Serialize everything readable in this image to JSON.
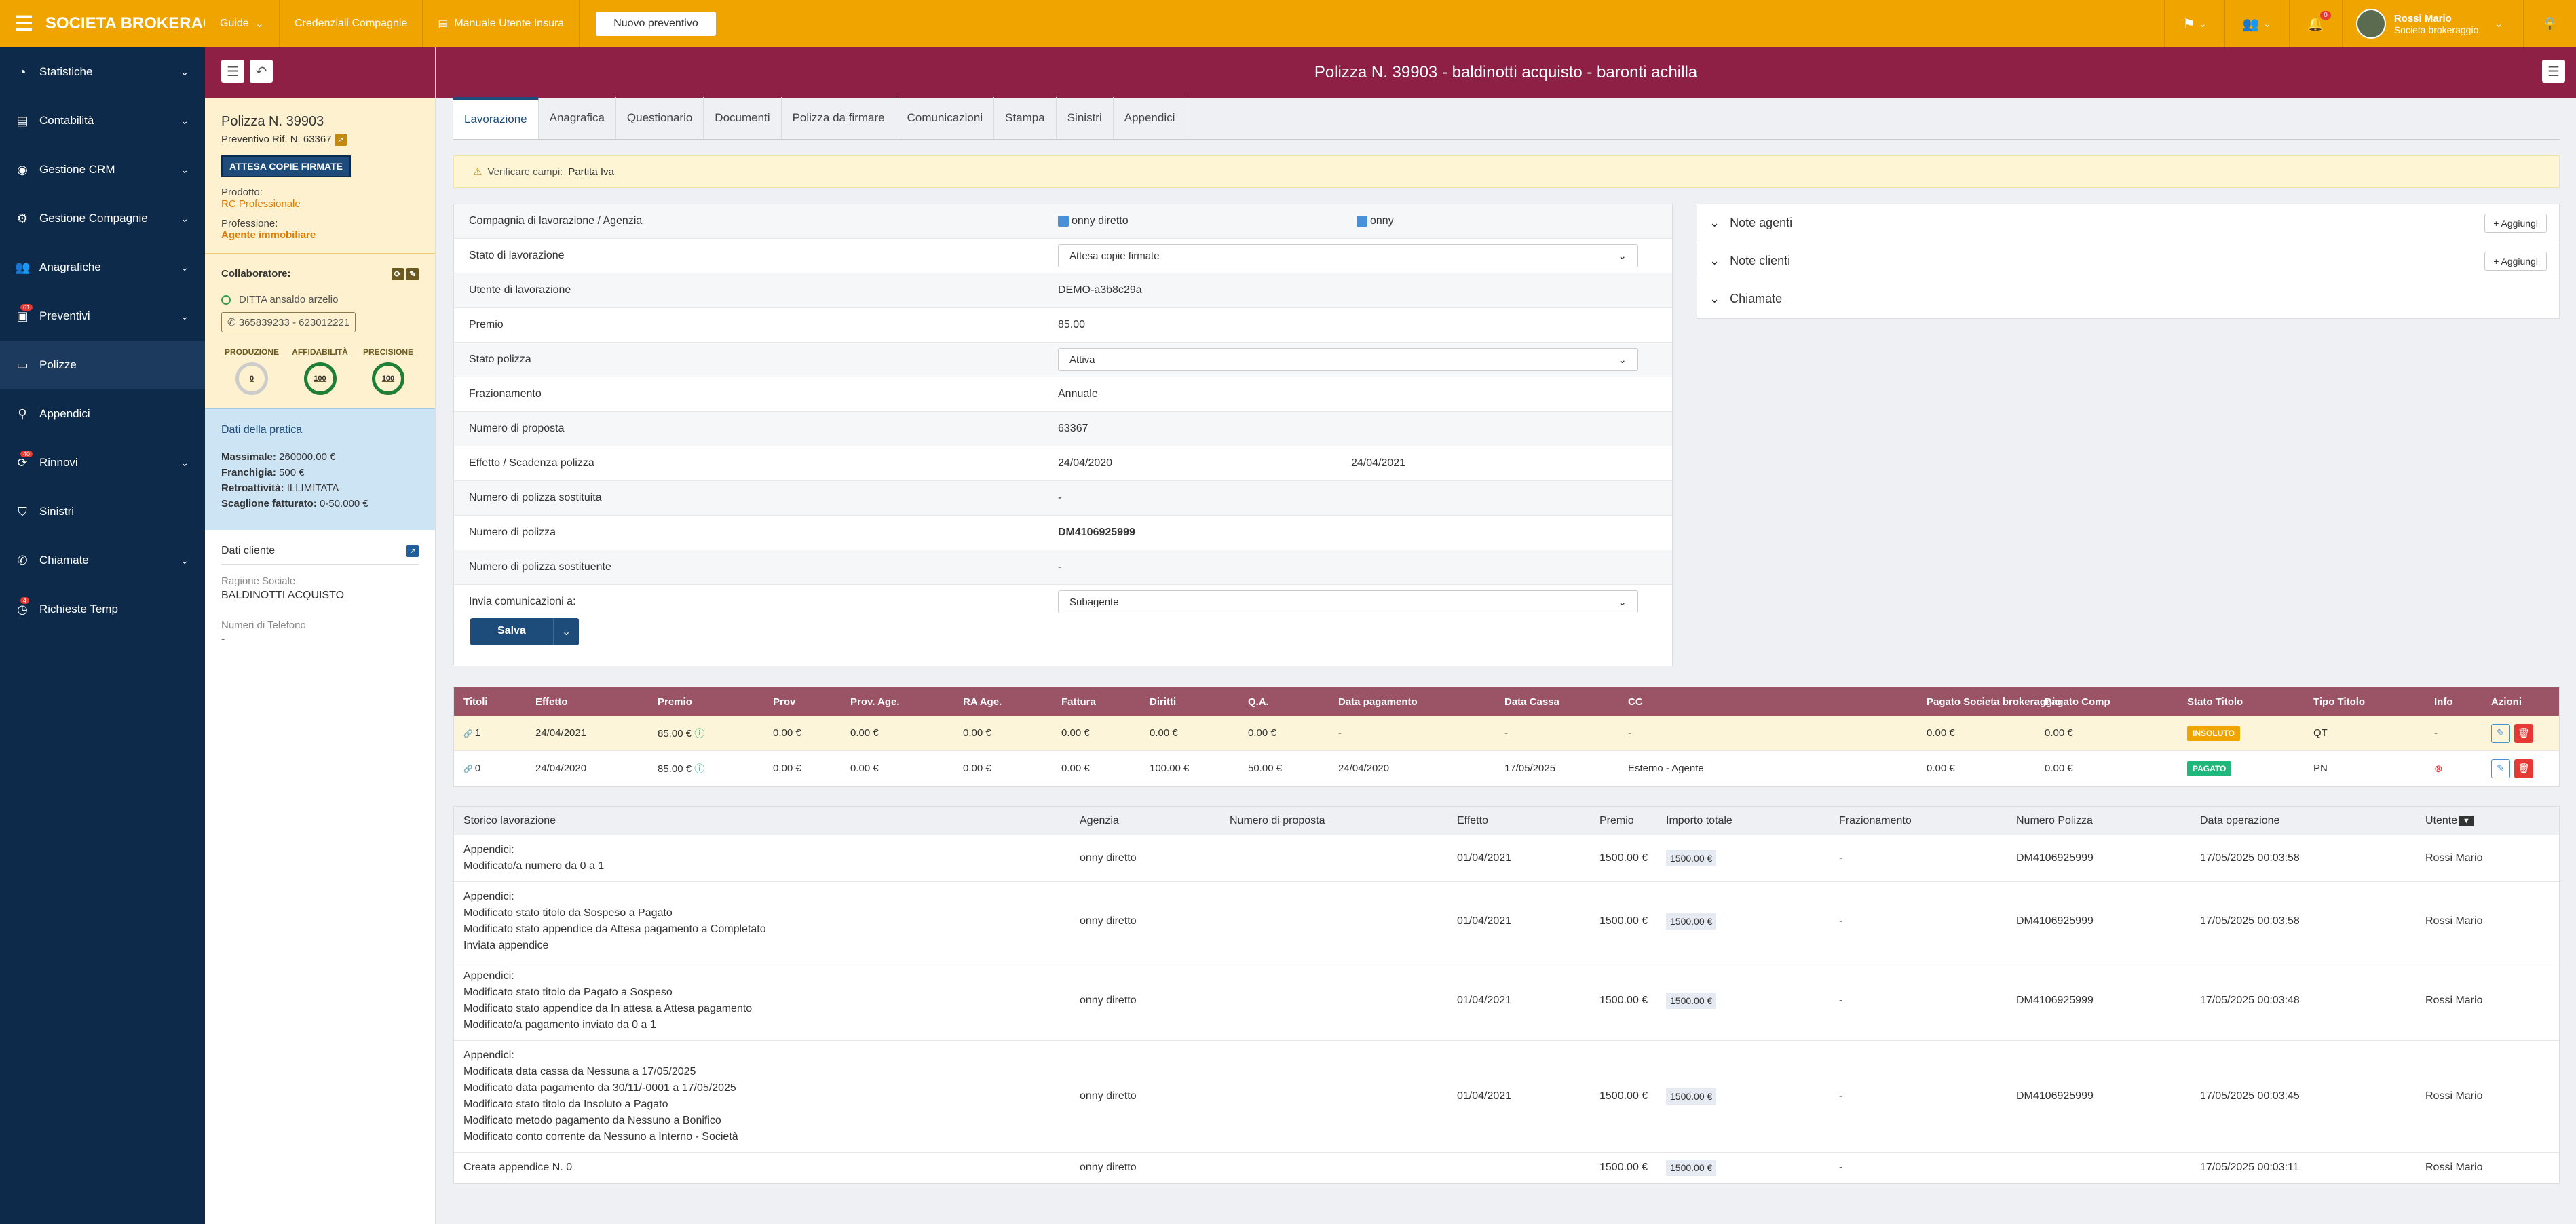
{
  "topbar": {
    "brand": "SOCIETA BROKERAG...",
    "nav": [
      "Guide",
      "Credenziali Compagnie",
      "Manuale Utente Insura"
    ],
    "new_button": "Nuovo preventivo",
    "user_name": "Rossi Mario",
    "user_role": "Societa brokeraggio",
    "notif_count": "0",
    "colors": {
      "accent": "#f0a400"
    }
  },
  "sidebar": {
    "items": [
      {
        "label": "Statistiche",
        "icon": "chart-icon",
        "chevron": true,
        "badge": ""
      },
      {
        "label": "Contabilità",
        "icon": "ledger-icon",
        "chevron": true,
        "badge": ""
      },
      {
        "label": "Gestione CRM",
        "icon": "crm-icon",
        "chevron": true,
        "badge": ""
      },
      {
        "label": "Gestione Compagnie",
        "icon": "building-icon",
        "chevron": true,
        "badge": ""
      },
      {
        "label": "Anagrafiche",
        "icon": "people-icon",
        "chevron": true,
        "badge": ""
      },
      {
        "label": "Preventivi",
        "icon": "document-icon",
        "chevron": true,
        "badge": "61"
      },
      {
        "label": "Polizze",
        "icon": "policy-icon",
        "chevron": false,
        "badge": ""
      },
      {
        "label": "Appendici",
        "icon": "appendix-icon",
        "chevron": false,
        "badge": ""
      },
      {
        "label": "Rinnovi",
        "icon": "refresh-icon",
        "chevron": true,
        "badge": "40"
      },
      {
        "label": "Sinistri",
        "icon": "shield-icon",
        "chevron": false,
        "badge": ""
      },
      {
        "label": "Chiamate",
        "icon": "phone-icon",
        "chevron": true,
        "badge": ""
      },
      {
        "label": "Richieste Temp",
        "icon": "clock-icon",
        "chevron": false,
        "badge": "4"
      }
    ]
  },
  "header": {
    "title": "Polizza N. 39903 - baldinotti acquisto - baronti achilla"
  },
  "left": {
    "policy_title": "Polizza N. 39903",
    "preventivo": "Preventivo Rif. N. 63367",
    "status": "ATTESA COPIE FIRMATE",
    "prodotto_label": "Prodotto:",
    "prodotto": "RC Professionale",
    "professione_label": "Professione:",
    "professione": "Agente immobiliare",
    "collaboratore_label": "Collaboratore:",
    "ditta": "DITTA ansaldo arzelio",
    "phone": "365839233 - 623012221",
    "metrics": [
      {
        "label": "PRODUZIONE",
        "value": "0"
      },
      {
        "label": "AFFIDABILITÀ",
        "value": "100"
      },
      {
        "label": "PRECISIONE",
        "value": "100"
      }
    ],
    "dati_title": "Dati della pratica",
    "dati": [
      {
        "k": "Massimale:",
        "v": "260000.00 €"
      },
      {
        "k": "Franchigia:",
        "v": "500 €"
      },
      {
        "k": "Retroattività:",
        "v": "ILLIMITATA"
      },
      {
        "k": "Scaglione fatturato:",
        "v": "0-50.000 €"
      }
    ],
    "cliente_title": "Dati cliente",
    "ragione_label": "Ragione Sociale",
    "ragione": "BALDINOTTI ACQUISTO",
    "tel_label": "Numeri di Telefono",
    "tel": "-"
  },
  "tabs": [
    "Lavorazione",
    "Anagrafica",
    "Questionario",
    "Documenti",
    "Polizza da firmare",
    "Comunicazioni",
    "Stampa",
    "Sinistri",
    "Appendici"
  ],
  "warning": {
    "text": "Verificare campi:",
    "field": "Partita Iva"
  },
  "form": {
    "rows": [
      {
        "label": "Compagnia di lavorazione / Agenzia",
        "type": "check",
        "v1": "onny diretto",
        "v2": "onny"
      },
      {
        "label": "Stato di lavorazione",
        "type": "select",
        "v1": "Attesa copie firmate"
      },
      {
        "label": "Utente di lavorazione",
        "type": "text",
        "v1": "DEMO-a3b8c29a"
      },
      {
        "label": "Premio",
        "type": "text",
        "v1": "85.00"
      },
      {
        "label": "Stato polizza",
        "type": "select",
        "v1": "Attiva"
      },
      {
        "label": "Frazionamento",
        "type": "text",
        "v1": "Annuale"
      },
      {
        "label": "Numero di proposta",
        "type": "text",
        "v1": "63367"
      },
      {
        "label": "Effetto / Scadenza polizza",
        "type": "two",
        "v1": "24/04/2020",
        "v2": "24/04/2021"
      },
      {
        "label": "Numero di polizza sostituita",
        "type": "text",
        "v1": "-"
      },
      {
        "label": "Numero di polizza",
        "type": "bold",
        "v1": "DM4106925999"
      },
      {
        "label": "Numero di polizza sostituente",
        "type": "text",
        "v1": "-"
      },
      {
        "label": "Invia comunicazioni a:",
        "type": "select",
        "v1": "Subagente"
      }
    ],
    "save": "Salva"
  },
  "notes": [
    {
      "label": "Note agenti",
      "add": "+ Aggiungi"
    },
    {
      "label": "Note clienti",
      "add": "+ Aggiungi"
    },
    {
      "label": "Chiamate",
      "add": ""
    }
  ],
  "titoli": {
    "headers": [
      "Titoli",
      "Effetto",
      "Premio",
      "Prov",
      "Prov. Age.",
      "RA Age.",
      "Fattura",
      "Diritti",
      "Q.A.",
      "Data pagamento",
      "Data Cassa",
      "CC",
      "Pagato Societa brokeraggio",
      "Pagato Comp",
      "Stato Titolo",
      "Tipo Titolo",
      "Info",
      "Azioni"
    ],
    "rows": [
      {
        "n": "1",
        "effetto": "24/04/2021",
        "premio": "85.00 €",
        "prov": "0.00 €",
        "prov_age": "0.00 €",
        "ra": "0.00 €",
        "fattura": "0.00 €",
        "diritti": "0.00 €",
        "qa": "0.00 €",
        "data_pag": "-",
        "cassa": "-",
        "cc": "-",
        "pag_soc": "0.00 €",
        "pag_comp": "0.00 €",
        "stato": "INSOLUTO",
        "stato_color": "#f0a400",
        "tipo": "QT",
        "info": "-"
      },
      {
        "n": "0",
        "effetto": "24/04/2020",
        "premio": "85.00 €",
        "prov": "0.00 €",
        "prov_age": "0.00 €",
        "ra": "0.00 €",
        "fattura": "0.00 €",
        "diritti": "100.00 €",
        "qa": "50.00 €",
        "data_pag": "24/04/2020",
        "cassa": "17/05/2025",
        "cc": "Esterno - Agente",
        "pag_soc": "0.00 €",
        "pag_comp": "0.00 €",
        "stato": "PAGATO",
        "stato_color": "#1fb87a",
        "tipo": "PN",
        "info": ""
      }
    ]
  },
  "storico": {
    "headers": [
      "Storico lavorazione",
      "Agenzia",
      "Numero di proposta",
      "Effetto",
      "Premio",
      "Importo totale",
      "Frazionamento",
      "Numero Polizza",
      "Data operazione",
      "Utente"
    ],
    "rows": [
      {
        "lines": [
          "Appendici:",
          "Modificato/a numero da 0 a 1"
        ],
        "agenzia": "onny diretto",
        "effetto": "01/04/2021",
        "premio": "1500.00 €",
        "importo": "1500.00 €",
        "fraz": "-",
        "polizza": "DM4106925999",
        "data": "17/05/2025 00:03:58",
        "utente": "Rossi Mario"
      },
      {
        "lines": [
          "Appendici:",
          "Modificato stato titolo da Sospeso a Pagato",
          "Modificato stato appendice da Attesa pagamento a Completato",
          "Inviata appendice"
        ],
        "agenzia": "onny diretto",
        "effetto": "01/04/2021",
        "premio": "1500.00 €",
        "importo": "1500.00 €",
        "fraz": "-",
        "polizza": "DM4106925999",
        "data": "17/05/2025 00:03:58",
        "utente": "Rossi Mario"
      },
      {
        "lines": [
          "Appendici:",
          "Modificato stato titolo da Pagato a Sospeso",
          "Modificato stato appendice da In attesa a Attesa pagamento",
          "Modificato/a pagamento inviato da 0 a 1"
        ],
        "agenzia": "onny diretto",
        "effetto": "01/04/2021",
        "premio": "1500.00 €",
        "importo": "1500.00 €",
        "fraz": "-",
        "polizza": "DM4106925999",
        "data": "17/05/2025 00:03:48",
        "utente": "Rossi Mario"
      },
      {
        "lines": [
          "Appendici:",
          "Modificata data cassa da Nessuna a 17/05/2025",
          "Modificato data pagamento da 30/11/-0001 a 17/05/2025",
          "Modificato stato titolo da Insoluto a Pagato",
          "Modificato metodo pagamento da Nessuno a Bonifico",
          "Modificato conto corrente da Nessuno a Interno - Società"
        ],
        "agenzia": "onny diretto",
        "effetto": "01/04/2021",
        "premio": "1500.00 €",
        "importo": "1500.00 €",
        "fraz": "-",
        "polizza": "DM4106925999",
        "data": "17/05/2025 00:03:45",
        "utente": "Rossi Mario"
      },
      {
        "lines": [
          "Creata appendice N. 0"
        ],
        "agenzia": "onny diretto",
        "effetto": "",
        "premio": "1500.00 €",
        "importo": "1500.00 €",
        "fraz": "-",
        "polizza": "",
        "data": "17/05/2025 00:03:11",
        "utente": "Rossi Mario"
      }
    ]
  }
}
